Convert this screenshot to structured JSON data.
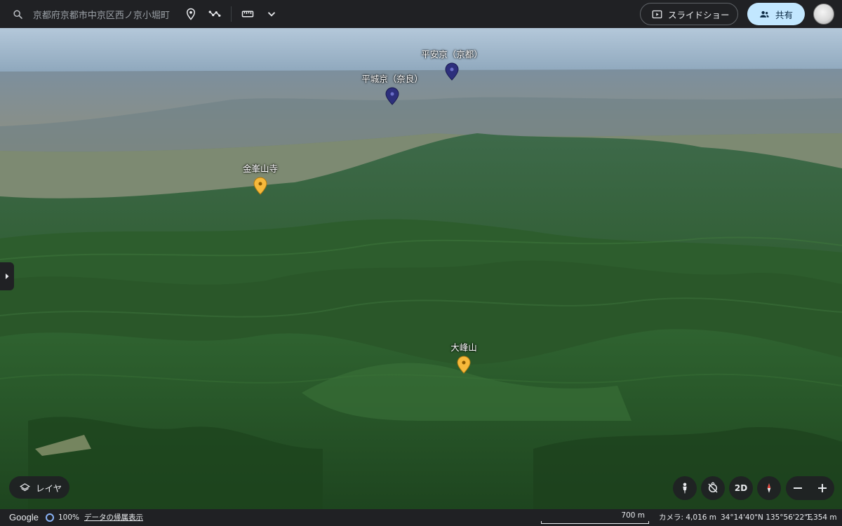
{
  "search": {
    "value": "京都府京都市中京区西ノ京小堀町",
    "icon": "search-icon"
  },
  "toolbar": {
    "icons": [
      "place-pin-icon",
      "path-icon",
      "ruler-icon",
      "chevron-down-icon"
    ]
  },
  "actions": {
    "slideshow_label": "スライドショー",
    "share_label": "共有"
  },
  "markers": [
    {
      "label": "平安京（京都）",
      "color": "#2d2f7c"
    },
    {
      "label": "平城京（奈良）",
      "color": "#2d2f7c"
    },
    {
      "label": "金峯山寺",
      "color": "#f6b93b"
    },
    {
      "label": "大峰山",
      "color": "#f6b93b"
    }
  ],
  "layers": {
    "label": "レイヤ"
  },
  "map_controls": {
    "toggle_2d_label": "2D"
  },
  "status": {
    "brand": "Google",
    "load_percent": "100%",
    "attribution": "データの帰属表示",
    "scale": "700 m",
    "camera": "カメラ: 4,016 m",
    "coordinates": "34°14'40\"N 135°56'22\"E",
    "elevation": "1,354 m"
  },
  "colors": {
    "accent_share": "#c2e7ff",
    "bar_bg": "#202124"
  }
}
